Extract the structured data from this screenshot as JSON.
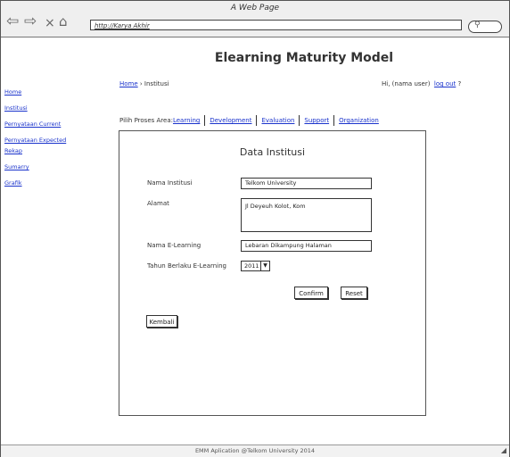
{
  "window": {
    "title": "A Web Page",
    "url": "http://Karya Akhir"
  },
  "header": {
    "title": "Elearning Maturity Model"
  },
  "sidebar": {
    "items": [
      {
        "label": "Home"
      },
      {
        "label": "Institusi"
      },
      {
        "label": "Pernyataan Current"
      },
      {
        "label": "Pernyataan Expected"
      },
      {
        "label": "Rekap"
      },
      {
        "label": "Sumarry"
      },
      {
        "label": "Grafik"
      }
    ]
  },
  "breadcrumb": {
    "home": "Home",
    "separator": " › ",
    "current": "Institusi"
  },
  "user": {
    "greeting": "Hi, (nama user)",
    "logout": "log out",
    "suffix": " ?"
  },
  "proses": {
    "label": "Pilih Proses Area:",
    "tabs": [
      {
        "label": "Learning"
      },
      {
        "label": "Development"
      },
      {
        "label": "Evaluation"
      },
      {
        "label": "Support"
      },
      {
        "label": "Organization"
      }
    ]
  },
  "form": {
    "title": "Data Institusi",
    "nama_institusi": {
      "label": "Nama Institusi",
      "value": "Telkom University"
    },
    "alamat": {
      "label": "Alamat",
      "value": "Jl Deyeuh Kolot, Kom"
    },
    "nama_elearning": {
      "label": "Nama E-Learning",
      "value": "Lebaran Dikampung Halaman"
    },
    "tahun": {
      "label": "Tahun Berlaku E-Learning",
      "value": "2011"
    },
    "confirm_label": "Confirm",
    "reset_label": "Reset",
    "back_label": "Kembali"
  },
  "footer": {
    "text": "EMM Aplication @Telkom University 2014"
  }
}
